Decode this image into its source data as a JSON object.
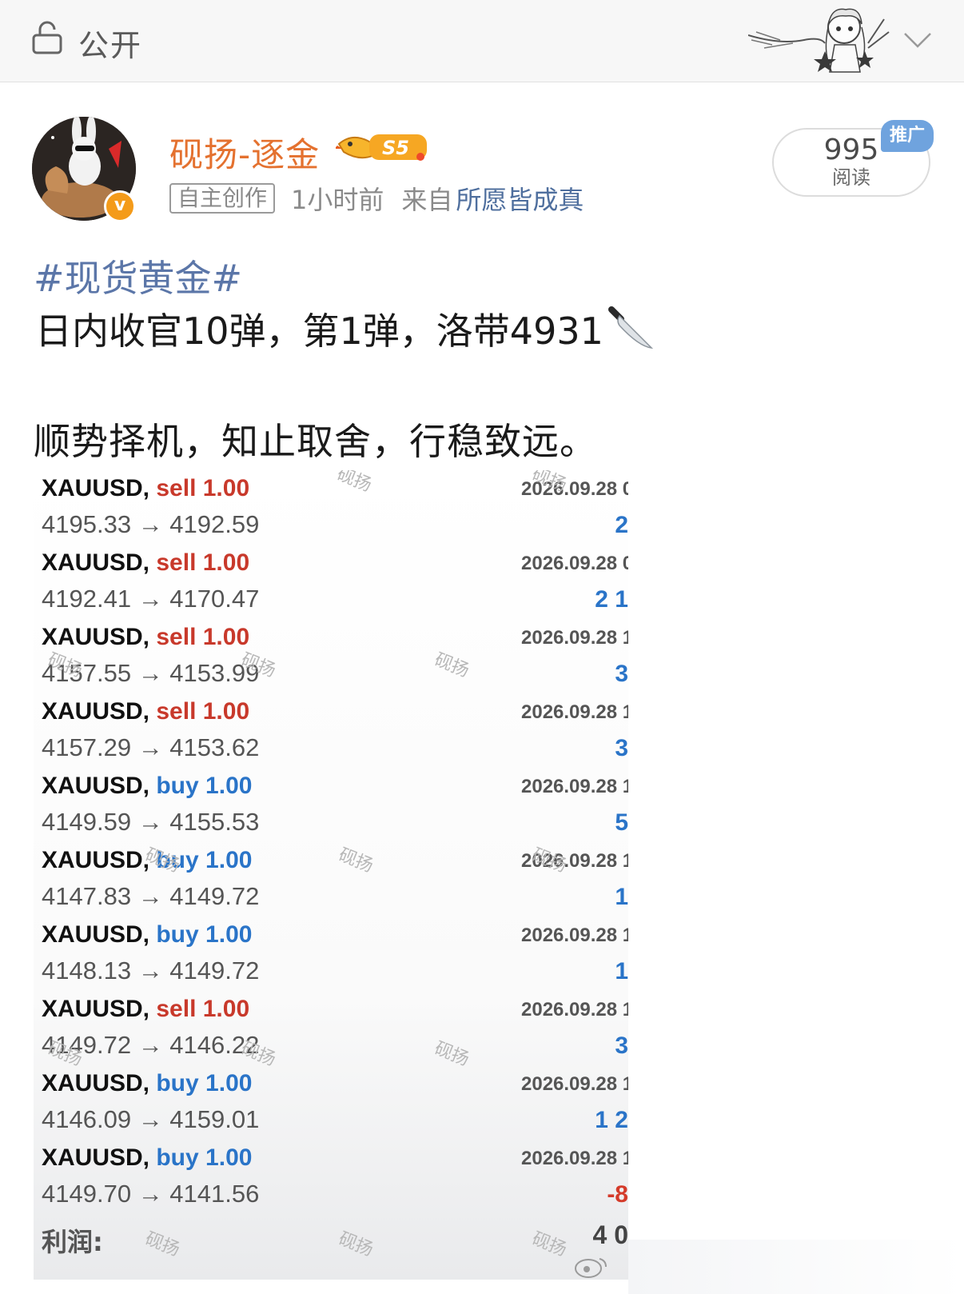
{
  "topbar": {
    "visibility_label": "公开",
    "icons": {
      "lock": "lock-icon",
      "chevron": "chevron-down-icon",
      "sticker": "anime-girl-sticker"
    }
  },
  "post_header": {
    "username": "砚扬-逐金",
    "level_badge": "S5",
    "creation_tag": "自主创作",
    "time": "1小时前",
    "source_prefix": "来自",
    "source_link": "所愿皆成真",
    "reads_count": "995",
    "reads_label": "阅读",
    "promo_label": "推广"
  },
  "post_body": {
    "hashtag": "#现货黄金#",
    "line1": "日内收官10弹，第1弹，洛带4931",
    "line2": "顺势择机，知止取舍，行稳致远。"
  },
  "trade_list": {
    "trades": [
      {
        "symbol": "XAUUSD,",
        "side": "sell",
        "lot": "1.00",
        "prices": "4195.33 → 4192.59",
        "date": "2026.09.28 0",
        "profit": "2"
      },
      {
        "symbol": "XAUUSD,",
        "side": "sell",
        "lot": "1.00",
        "prices": "4192.41 → 4170.47",
        "date": "2026.09.28 0",
        "profit": "2 1"
      },
      {
        "symbol": "XAUUSD,",
        "side": "sell",
        "lot": "1.00",
        "prices": "4157.55 → 4153.99",
        "date": "2026.09.28 1",
        "profit": "3"
      },
      {
        "symbol": "XAUUSD,",
        "side": "sell",
        "lot": "1.00",
        "prices": "4157.29 → 4153.62",
        "date": "2026.09.28 1",
        "profit": "3"
      },
      {
        "symbol": "XAUUSD,",
        "side": "buy",
        "lot": "1.00",
        "prices": "4149.59 → 4155.53",
        "date": "2026.09.28 1",
        "profit": "5"
      },
      {
        "symbol": "XAUUSD,",
        "side": "buy",
        "lot": "1.00",
        "prices": "4147.83 → 4149.72",
        "date": "2026.09.28 1",
        "profit": "1"
      },
      {
        "symbol": "XAUUSD,",
        "side": "buy",
        "lot": "1.00",
        "prices": "4148.13 → 4149.72",
        "date": "2026.09.28 1",
        "profit": "1"
      },
      {
        "symbol": "XAUUSD,",
        "side": "sell",
        "lot": "1.00",
        "prices": "4149.72 → 4146.22",
        "date": "2026.09.28 1",
        "profit": "3"
      },
      {
        "symbol": "XAUUSD,",
        "side": "buy",
        "lot": "1.00",
        "prices": "4146.09 → 4159.01",
        "date": "2026.09.28 1",
        "profit": "1 2"
      },
      {
        "symbol": "XAUUSD,",
        "side": "buy",
        "lot": "1.00",
        "prices": "4149.70 → 4141.56",
        "date": "2026.09.28 1",
        "profit": "-8"
      }
    ],
    "profit_label": "利润:",
    "profit_total": "4 0",
    "watermark": "砚扬"
  },
  "colors": {
    "username": "#e4712f",
    "hashtag": "#5b76a8",
    "sell": "#c8392b",
    "buy": "#2a74c8",
    "verified": "#f49b1a",
    "promo": "#6fa3de"
  }
}
